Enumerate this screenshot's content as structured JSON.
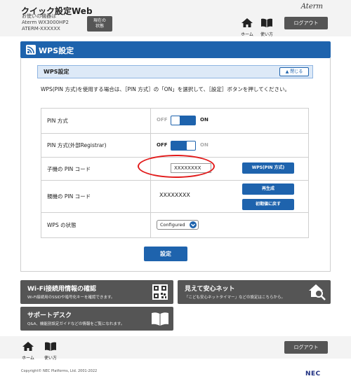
{
  "header": {
    "app_title": "クイック設定Web",
    "device_lines": [
      "お使いの機器は",
      "Aterm  WX3000HP2",
      "ATERM-XXXXXX"
    ],
    "status_button": [
      "現在の",
      "状態"
    ],
    "brand": "Aterm",
    "home_label": "ホーム",
    "help_label": "使い方",
    "logout_label": "ログアウト"
  },
  "section": {
    "title": "WPS設定",
    "icon": "wifi-icon"
  },
  "subsection": {
    "title": "WPS設定",
    "close_label": "閉じる"
  },
  "description": "WPS(PIN 方式)を使用する場合は、［PIN 方式］の「ON」を選択して、［設定］ボタンを押してください。",
  "table": {
    "rows": [
      {
        "label": "PIN 方式",
        "off": "OFF",
        "on": "ON"
      },
      {
        "label": "PIN 方式(外部Registrar)",
        "off": "OFF",
        "on": "ON"
      },
      {
        "label": "子機の PIN コード",
        "input_value": "XXXXXXXX",
        "button": "WPS(PIN 方式)"
      },
      {
        "label": "親機の PIN コード",
        "value": "XXXXXXXX",
        "button_regen": "再生成",
        "button_reset": "初期値に戻す"
      },
      {
        "label": "WPS の状態",
        "select_value": "Configured"
      }
    ]
  },
  "submit_label": "設定",
  "cards": [
    {
      "title": "Wi-Fi接続用情報の確認",
      "sub": "Wi-Fi接続用のSSIDや暗号化キーを確認できます。",
      "icon": "qr-code-icon"
    },
    {
      "title": "見えて安心ネット",
      "sub": "「こども安心ネットタイマー」などの設定はこちらから。",
      "icon": "home-search-icon"
    },
    {
      "title": "サポートデスク",
      "sub": "Q&A、機能別設定ガイドなどの情報をご覧になれます。",
      "icon": "book-icon"
    }
  ],
  "footer": {
    "home_label": "ホーム",
    "help_label": "使い方",
    "logout_label": "ログアウト",
    "copyright": "Copyright© NEC Platforms, Ltd. 2001-2022",
    "logo": "NEC"
  },
  "colors": {
    "accent": "#1e63ad",
    "highlight": "#e21b1b",
    "dark_button": "#555555"
  }
}
